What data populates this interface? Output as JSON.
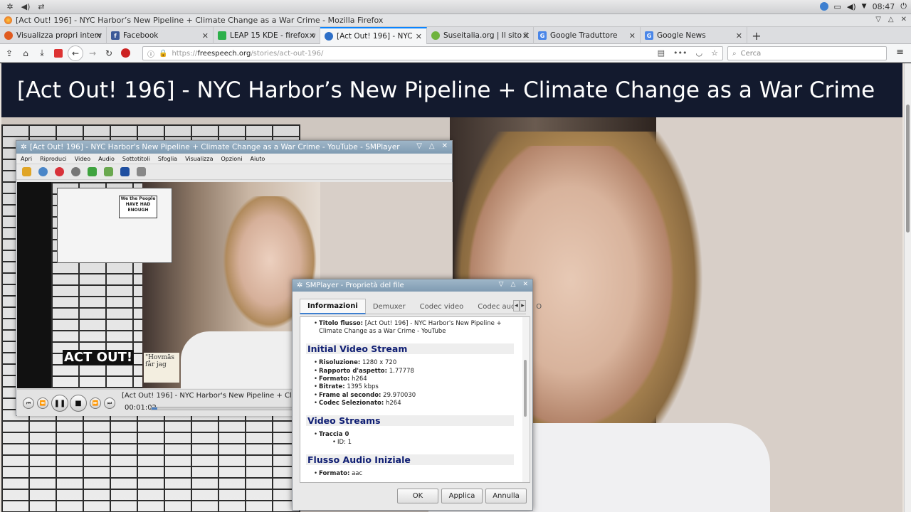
{
  "panel": {
    "clock": "08:47"
  },
  "firefox": {
    "window_title": "[Act Out! 196] - NYC Harbor’s New Pipeline + Climate Change as a War Crime - Mozilla Firefox",
    "tabs": [
      {
        "label": "Visualizza propri interventi -",
        "color": "#e05a1f",
        "icon": "ubuntu-icon"
      },
      {
        "label": "Facebook",
        "color": "#3b5998",
        "icon": "facebook-icon"
      },
      {
        "label": "LEAP 15 KDE - firefox vide",
        "color": "#2db04a",
        "icon": "leap-icon"
      },
      {
        "label": "[Act Out! 196] - NYC Ha",
        "color": "#2d6fc7",
        "icon": "freespeech-icon"
      },
      {
        "label": "Suseitalia.org | Il sito italian",
        "color": "#6fb33d",
        "icon": "suse-icon"
      },
      {
        "label": "Google Traduttore",
        "color": "#4a86e8",
        "icon": "translate-icon"
      },
      {
        "label": "Google News",
        "color": "#4a86e8",
        "icon": "news-icon"
      }
    ],
    "url_prefix": "https://",
    "url_host": "freespeech.org",
    "url_path": "/stories/act-out-196/",
    "search_placeholder": "Cerca"
  },
  "page": {
    "title": "[Act Out! 196] - NYC Harbor’s New Pipeline + Climate Change as a War Crime"
  },
  "smplayer": {
    "title": "[Act Out! 196] - NYC Harbor's New Pipeline + Climate Change as a War Crime - YouTube - SMPlayer",
    "menu": [
      "Apri",
      "Riproduci",
      "Video",
      "Audio",
      "Sottotitoli",
      "Sfoglia",
      "Visualizza",
      "Opzioni",
      "Aiuto"
    ],
    "poster_sign": "We the People HAVE HAD ENOUGH",
    "actout_logo": "ACT OUT!",
    "book_text": "\"Hovmäs får jag",
    "now_playing": "[Act Out! 196] - NYC Harbor's New Pipeline + Climate Change a",
    "time": "00:01:02",
    "progress": 0.04
  },
  "dialog": {
    "title": "SMPlayer - Proprietà del file",
    "tabs": [
      "Informazioni",
      "Demuxer",
      "Codec video",
      "Codec audio",
      "O"
    ],
    "stream_title_label": "Titolo flusso:",
    "stream_title_value": "[Act Out! 196] - NYC Harbor's New Pipeline + Climate Change as a War Crime - YouTube",
    "initial_video_heading": "Initial Video Stream",
    "video_props": [
      {
        "label": "Risoluzione:",
        "value": "1280 x 720"
      },
      {
        "label": "Rapporto d'aspetto:",
        "value": "1.77778"
      },
      {
        "label": "Formato:",
        "value": "h264"
      },
      {
        "label": "Bitrate:",
        "value": "1395 kbps"
      },
      {
        "label": "Frame al secondo:",
        "value": "29.970030"
      },
      {
        "label": "Codec Selezionato:",
        "value": "h264"
      }
    ],
    "video_streams_heading": "Video Streams",
    "track_label": "Traccia 0",
    "track_id": "ID: 1",
    "audio_heading": "Flusso Audio Iniziale",
    "audio_format_label": "Formato:",
    "audio_format_value": "aac",
    "buttons": {
      "ok": "OK",
      "apply": "Applica",
      "cancel": "Annulla"
    }
  }
}
